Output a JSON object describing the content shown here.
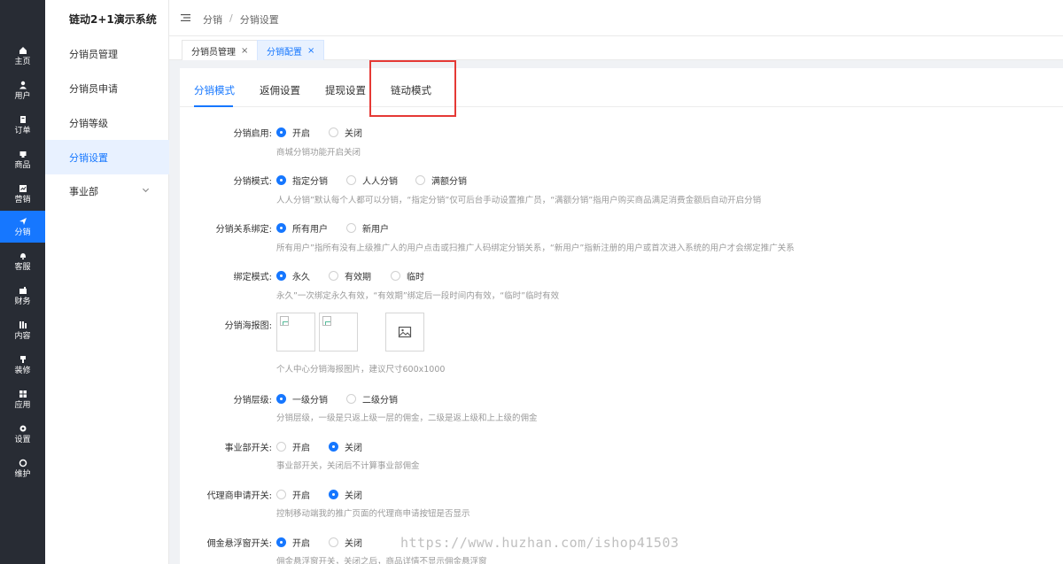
{
  "rail": {
    "items": [
      {
        "label": "主页",
        "icon": "home-icon"
      },
      {
        "label": "用户",
        "icon": "user-icon"
      },
      {
        "label": "订单",
        "icon": "order-icon"
      },
      {
        "label": "商品",
        "icon": "product-icon"
      },
      {
        "label": "营销",
        "icon": "marketing-icon"
      },
      {
        "label": "分销",
        "icon": "send-icon",
        "active": true
      },
      {
        "label": "客服",
        "icon": "bell-icon"
      },
      {
        "label": "财务",
        "icon": "finance-icon"
      },
      {
        "label": "内容",
        "icon": "content-icon"
      },
      {
        "label": "装修",
        "icon": "brush-icon"
      },
      {
        "label": "应用",
        "icon": "apps-icon"
      },
      {
        "label": "设置",
        "icon": "gear-icon"
      },
      {
        "label": "维护",
        "icon": "maintain-icon"
      }
    ]
  },
  "sub": {
    "title": "链动2+1演示系统",
    "items": [
      "分销员管理",
      "分销员申请",
      "分销等级",
      "分销设置",
      "事业部"
    ]
  },
  "header": {
    "crumb1": "分销",
    "sep": "/",
    "crumb2": "分销设置"
  },
  "page_tabs": [
    {
      "label": "分销员管理",
      "close": "×"
    },
    {
      "label": "分销配置",
      "close": "×",
      "active": true
    }
  ],
  "content_tabs": [
    "分销模式",
    "返佣设置",
    "提现设置",
    "链动模式"
  ],
  "form": {
    "enable": {
      "label": "分销启用:",
      "options": [
        "开启",
        "关闭"
      ],
      "selected": 0,
      "hint": "商城分销功能开启关闭"
    },
    "mode": {
      "label": "分销模式:",
      "options": [
        "指定分销",
        "人人分销",
        "满额分销"
      ],
      "selected": 0,
      "hint": "人人分销”默认每个人都可以分销，“指定分销”仅可后台手动设置推广员，“满额分销”指用户购买商品满足消费金额后自动开启分销"
    },
    "binding": {
      "label": "分销关系绑定:",
      "options": [
        "所有用户",
        "新用户"
      ],
      "selected": 0,
      "hint": "所有用户”指所有没有上级推广人的用户点击或扫推广人码绑定分销关系，“新用户”指新注册的用户或首次进入系统的用户才会绑定推广关系"
    },
    "bind_mode": {
      "label": "绑定模式:",
      "options": [
        "永久",
        "有效期",
        "临时"
      ],
      "selected": 0,
      "hint": "永久”一次绑定永久有效，“有效期”绑定后一段时间内有效，“临时”临时有效"
    },
    "poster": {
      "label": "分销海报图:",
      "hint": "个人中心分销海报图片，建议尺寸600x1000"
    },
    "level": {
      "label": "分销层级:",
      "options": [
        "一级分销",
        "二级分销"
      ],
      "selected": 0,
      "hint": "分销层级，一级是只返上级一层的佣金，二级是返上级和上上级的佣金"
    },
    "division": {
      "label": "事业部开关:",
      "options": [
        "开启",
        "关闭"
      ],
      "selected": 1,
      "hint": "事业部开关，关闭后不计算事业部佣金"
    },
    "agent": {
      "label": "代理商申请开关:",
      "options": [
        "开启",
        "关闭"
      ],
      "selected": 1,
      "hint": "控制移动端我的推广页面的代理商申请按钮是否显示"
    },
    "float": {
      "label": "佣金悬浮窗开关:",
      "options": [
        "开启",
        "关闭"
      ],
      "selected": 0,
      "hint": "佣金悬浮窗开关，关闭之后，商品详情不显示佣金悬浮窗"
    }
  },
  "watermark": "https://www.huzhan.com/ishop41503",
  "colors": {
    "accent": "#1677ff",
    "rail_bg": "#282c34",
    "highlight": "#e53935"
  }
}
